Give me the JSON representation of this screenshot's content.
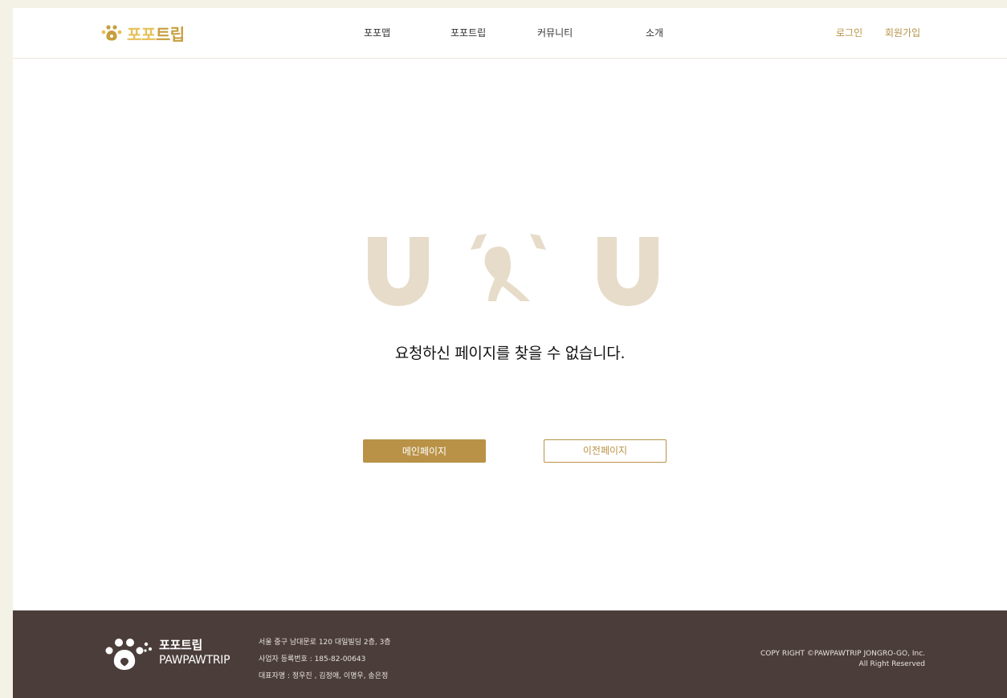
{
  "brand": {
    "logo_text_a": "포포",
    "logo_text_b": "트립",
    "footer_name_ko": "포포트립",
    "footer_name_en": "PAWPAWTRIP"
  },
  "nav": {
    "items": [
      {
        "label": "포포맵"
      },
      {
        "label": "포포트립"
      },
      {
        "label": "커뮤니티"
      },
      {
        "label": "소개"
      }
    ],
    "login_label": "로그인",
    "signup_label": "회원가입"
  },
  "error": {
    "message": "요청하신 페이지를 찾을 수 없습니다.",
    "main_button_label": "메인페이지",
    "prev_button_label": "이전페이지"
  },
  "footer": {
    "address": "서울 중구 남대문로 120 대일빌딩 2층, 3층",
    "business_number": "사업자 등록번호 : 185-82-00643",
    "representatives": "대표자명 : 정우진 , 김정애, 이명우, 송은정",
    "copyright_line1": "COPY RIGHT ©PAWPAWTRIP JONGRO-GO, Inc.",
    "copyright_line2": "All Right Reserved"
  },
  "colors": {
    "accent": "#b99247",
    "logo_light": "#e6c159",
    "face_beige": "#e6dcc9",
    "footer_bg": "#4b3e3a"
  },
  "icons": {
    "logo": "paw-icon",
    "error_face": "dog-face-icon"
  }
}
